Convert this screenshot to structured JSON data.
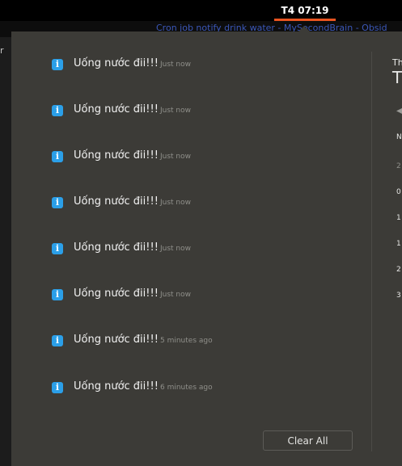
{
  "topbar": {
    "clock": "T4 07:19",
    "window_title": "Cron job notify drink water - MySecondBrain - Obsid"
  },
  "left_strip_glyph": "r",
  "notifications": [
    {
      "title": "Uống nước đii!!!",
      "time": "Just now"
    },
    {
      "title": "Uống nước đii!!!",
      "time": "Just now"
    },
    {
      "title": "Uống nước đii!!!",
      "time": "Just now"
    },
    {
      "title": "Uống nước đii!!!",
      "time": "Just now"
    },
    {
      "title": "Uống nước đii!!!",
      "time": "Just now"
    },
    {
      "title": "Uống nước đii!!!",
      "time": "Just now"
    },
    {
      "title": "Uống nước đii!!!",
      "time": "5 minutes ago"
    },
    {
      "title": "Uống nước đii!!!",
      "time": "6 minutes ago"
    }
  ],
  "notification_icon": "info-icon",
  "clear_all_label": "Clear All",
  "calendar": {
    "header_small": "Th",
    "header_large": "T",
    "prev_icon": "chevron-left-icon",
    "week_labels": [
      "N",
      "2",
      "0",
      "1",
      "1",
      "2",
      "3"
    ]
  },
  "colors": {
    "panel": "#3c3b37",
    "accent": "#e95420",
    "info": "#2b9fe8"
  }
}
